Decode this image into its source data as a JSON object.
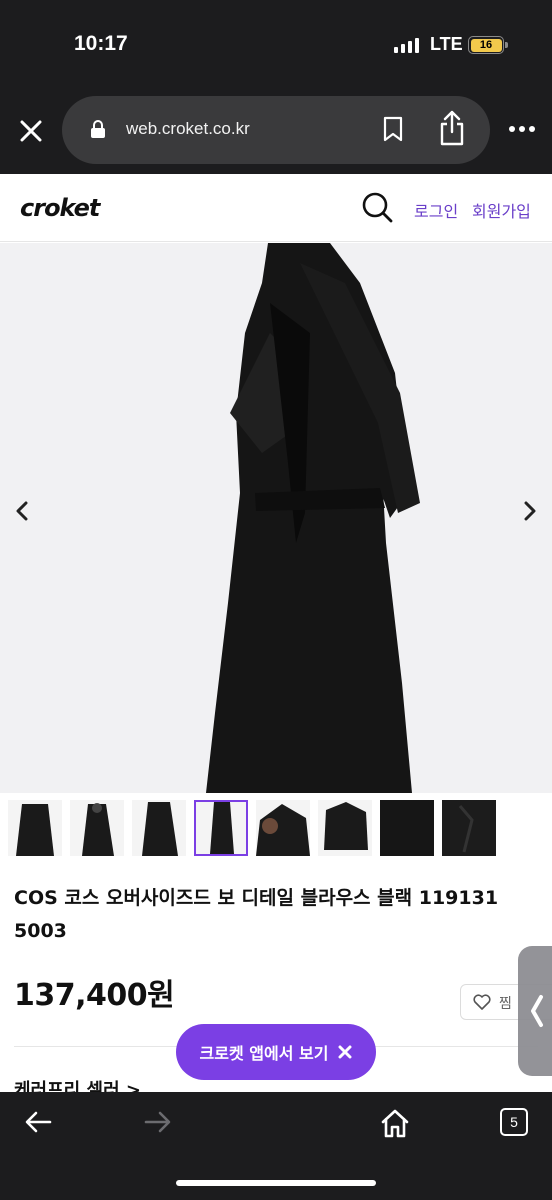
{
  "status_bar": {
    "time": "10:17",
    "network": "LTE",
    "battery": "16"
  },
  "browser": {
    "url": "web.croket.co.kr",
    "tab_count": "5"
  },
  "site": {
    "logo": "croket",
    "login_label": "로그인",
    "signup_label": "회원가입"
  },
  "product": {
    "title": "COS 코스 오버사이즈드 보 디테일 블라우스 블랙 119131 5003",
    "price": "137,400원",
    "like_label": "찜",
    "seller_link": "케러프리 셀러 >",
    "thumbnail_count": 8,
    "active_thumbnail": 4
  },
  "app_banner": {
    "label": "크로켓 앱에서 보기"
  },
  "icons": [
    "close-icon",
    "lock-icon",
    "bookmark-icon",
    "share-icon",
    "more-icon",
    "search-icon",
    "chevron-left-icon",
    "chevron-right-icon",
    "heart-icon",
    "back-icon",
    "forward-icon",
    "home-icon"
  ],
  "colors": {
    "accent": "#7b3fe4",
    "link": "#6a3fc9",
    "chrome": "#1c1c1e"
  }
}
